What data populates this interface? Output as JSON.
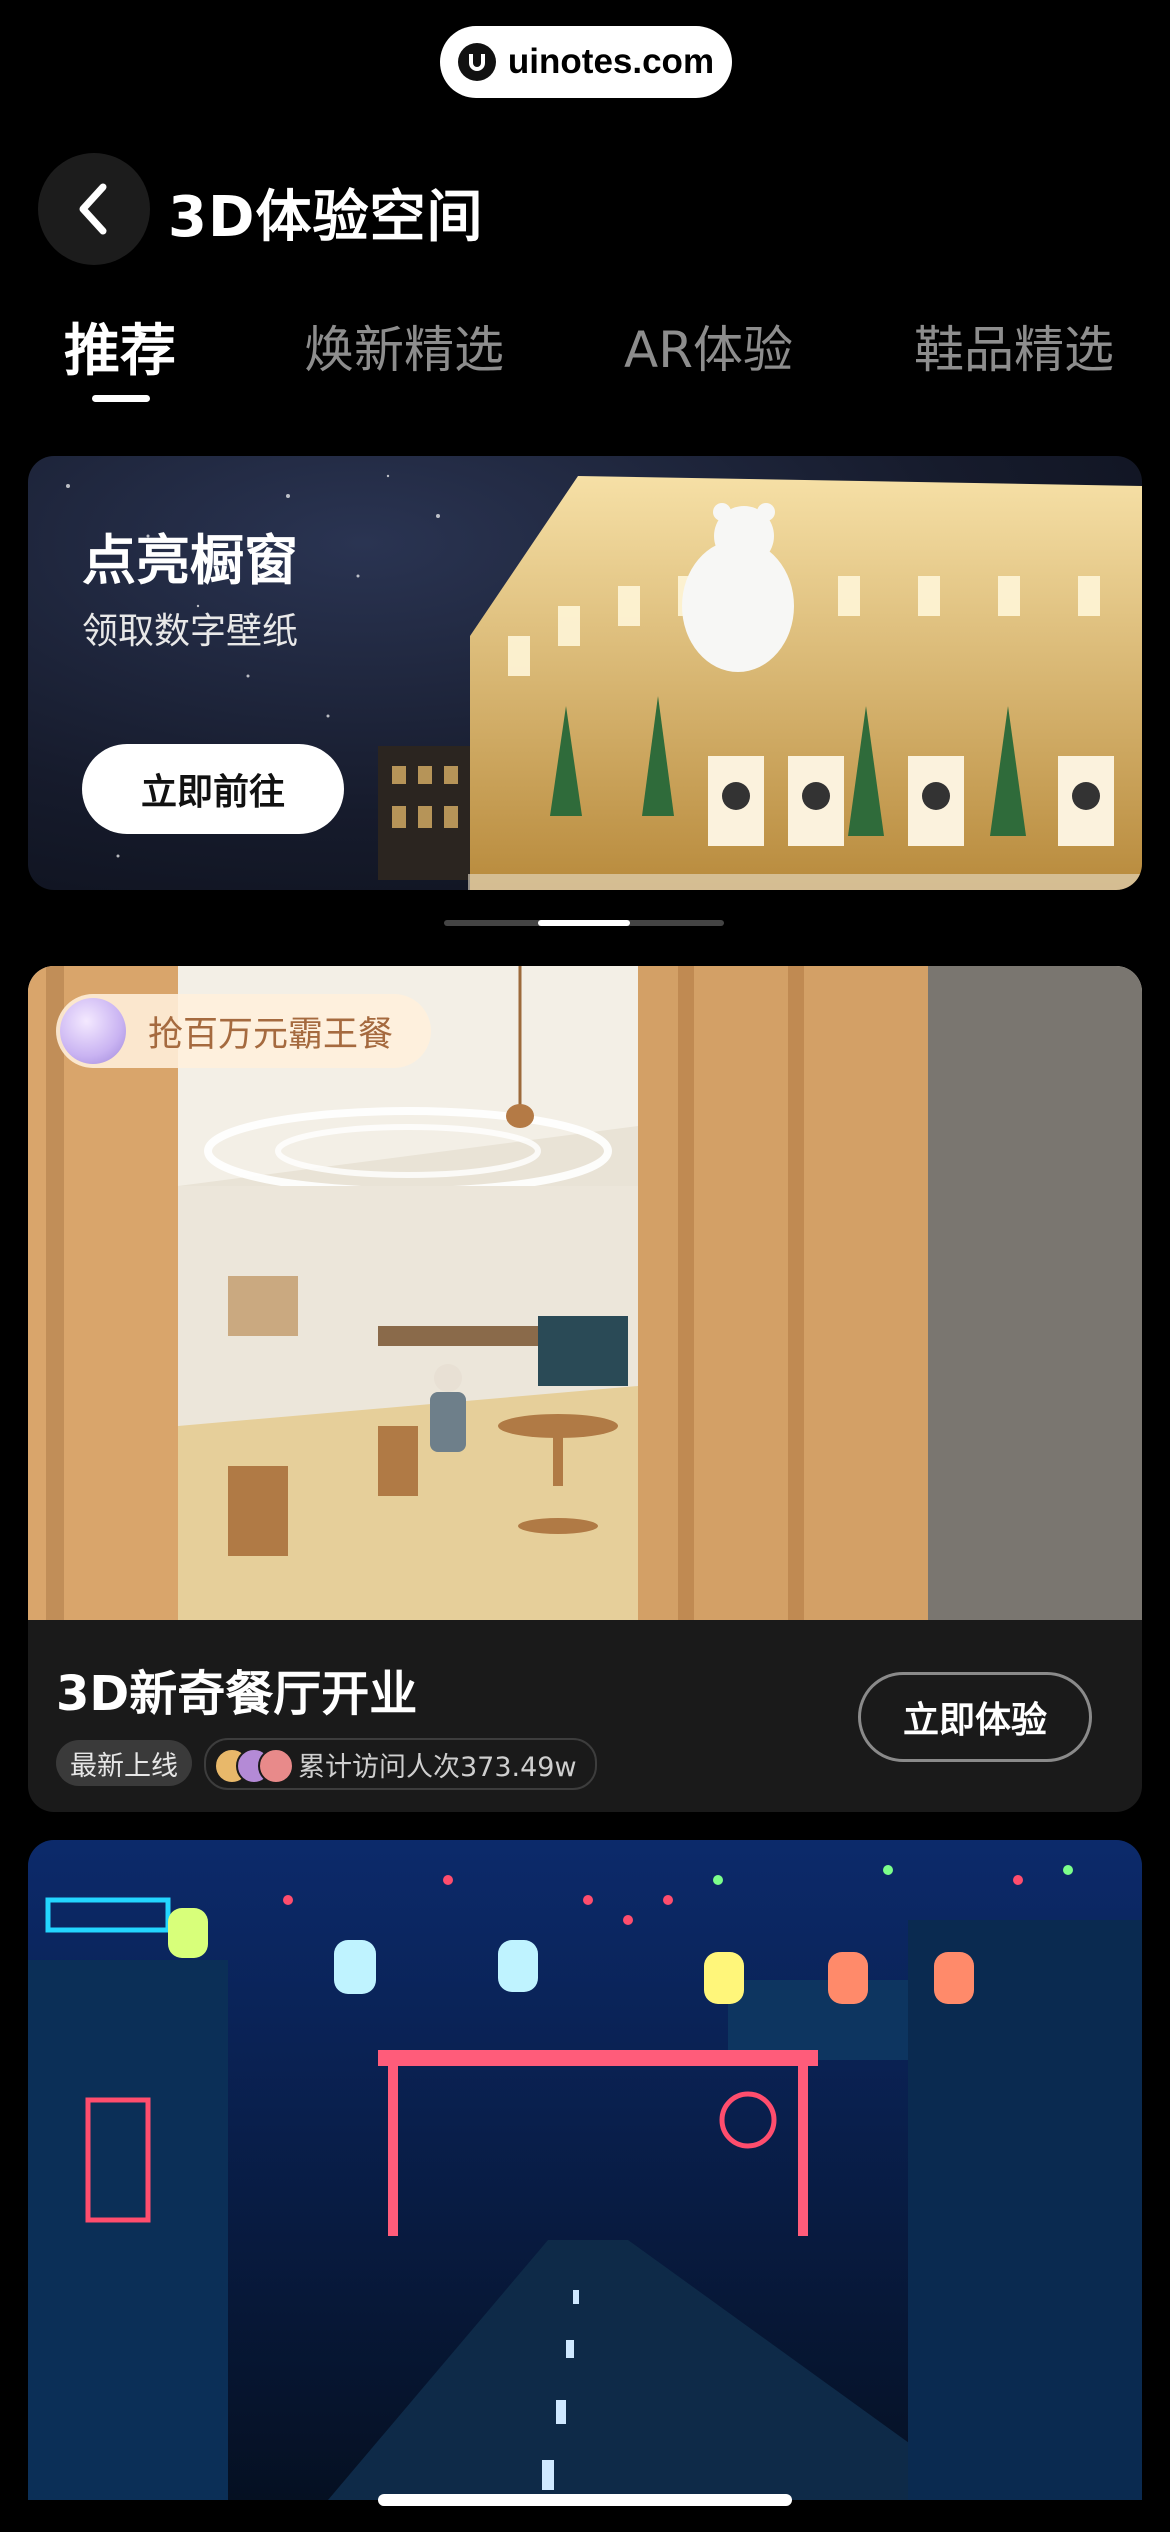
{
  "watermark": {
    "text": "uinotes.com"
  },
  "header": {
    "title": "3D体验空间"
  },
  "tabs": [
    {
      "label": "推荐",
      "active": true
    },
    {
      "label": "焕新精选",
      "active": false
    },
    {
      "label": "AR体验",
      "active": false
    },
    {
      "label": "鞋品精选",
      "active": false
    }
  ],
  "banner": {
    "title": "点亮橱窗",
    "subtitle": "领取数字壁纸",
    "button_label": "立即前往"
  },
  "pager": {
    "total": 3,
    "active_index": 1
  },
  "cards": [
    {
      "promo_label": "抢百万元霸王餐",
      "title": "3D新奇餐厅开业",
      "tag": "最新上线",
      "visits_text": "累计访问人次373.49w",
      "button_label": "立即体验"
    }
  ],
  "colors": {
    "background": "#000000",
    "tab_inactive": "#8d8d8d",
    "card_bg": "#1a1a1a",
    "promo_text": "#a56a3f"
  }
}
